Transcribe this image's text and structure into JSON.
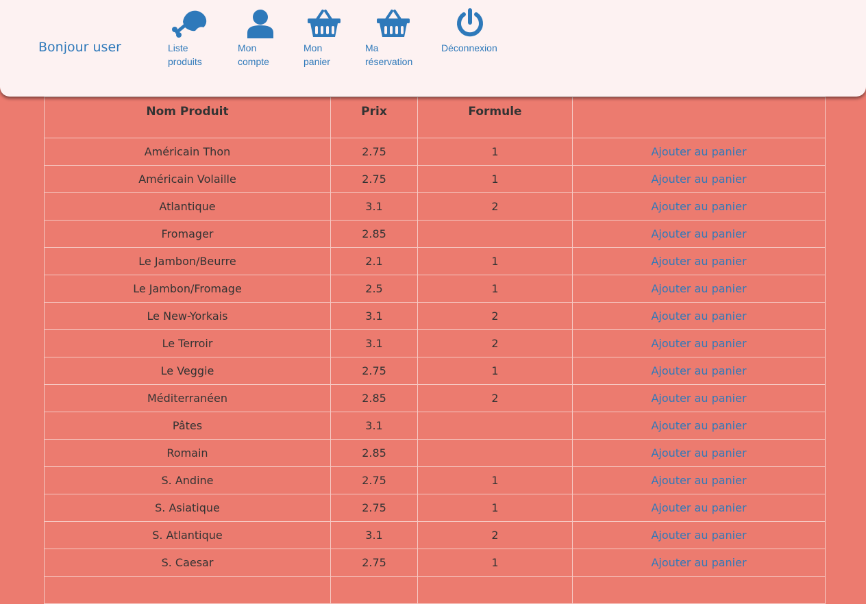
{
  "header": {
    "greeting": "Bonjour user",
    "nav": [
      {
        "line1": "Liste",
        "line2": "produits",
        "icon": "drumstick-icon"
      },
      {
        "line1": "Mon",
        "line2": "compte",
        "icon": "user-icon"
      },
      {
        "line1": "Mon",
        "line2": "panier",
        "icon": "basket-icon"
      },
      {
        "line1": "Ma",
        "line2": "réservation",
        "icon": "basket-icon"
      },
      {
        "line1": "Déconnexion",
        "line2": "",
        "icon": "power-icon"
      }
    ]
  },
  "table": {
    "headers": [
      "Nom Produit",
      "Prix",
      "Formule",
      ""
    ],
    "action_label": "Ajouter au panier",
    "rows": [
      {
        "name": "Américain Thon",
        "price": "2.75",
        "formule": "1"
      },
      {
        "name": "Américain Volaille",
        "price": "2.75",
        "formule": "1"
      },
      {
        "name": "Atlantique",
        "price": "3.1",
        "formule": "2"
      },
      {
        "name": "Fromager",
        "price": "2.85",
        "formule": ""
      },
      {
        "name": "Le Jambon/Beurre",
        "price": "2.1",
        "formule": "1"
      },
      {
        "name": "Le Jambon/Fromage",
        "price": "2.5",
        "formule": "1"
      },
      {
        "name": "Le New-Yorkais",
        "price": "3.1",
        "formule": "2"
      },
      {
        "name": "Le Terroir",
        "price": "3.1",
        "formule": "2"
      },
      {
        "name": "Le Veggie",
        "price": "2.75",
        "formule": "1"
      },
      {
        "name": "Méditerranéen",
        "price": "2.85",
        "formule": "2"
      },
      {
        "name": "Pâtes",
        "price": "3.1",
        "formule": ""
      },
      {
        "name": "Romain",
        "price": "2.85",
        "formule": ""
      },
      {
        "name": "S. Andine",
        "price": "2.75",
        "formule": "1"
      },
      {
        "name": "S. Asiatique",
        "price": "2.75",
        "formule": "1"
      },
      {
        "name": "S. Atlantique",
        "price": "3.1",
        "formule": "2"
      },
      {
        "name": "S. Caesar",
        "price": "2.75",
        "formule": "1"
      },
      {
        "name": "",
        "price": "",
        "formule": ""
      }
    ]
  },
  "colors": {
    "background": "#ec7b6f",
    "header_bg": "#fdf2f2",
    "accent": "#2e79ba",
    "text": "#333333"
  }
}
